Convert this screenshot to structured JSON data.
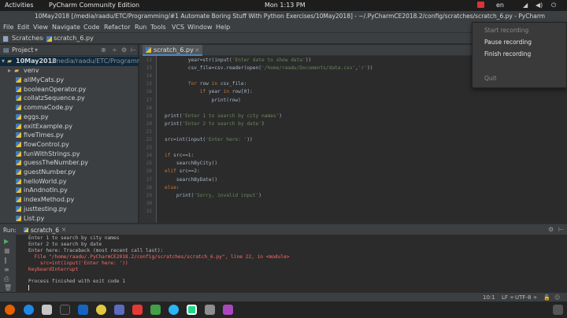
{
  "topbar": {
    "activities": "Activities",
    "app_menu": "PyCharm Community Edition",
    "clock": "Mon 1:13 PM",
    "lang": "en"
  },
  "window": {
    "title": "10May2018 [/media/raadu/ETC/Programming/#1 Automate Boring Stuff With Python Exercises/10May2018] - ~/.PyCharmCE2018.2/config/scratches/scratch_6.py - PyCharm"
  },
  "menubar": [
    "File",
    "Edit",
    "View",
    "Navigate",
    "Code",
    "Refactor",
    "Run",
    "Tools",
    "VCS",
    "Window",
    "Help"
  ],
  "navbar": {
    "crumb1": "Scratches",
    "crumb2": "scratch_6.py"
  },
  "project": {
    "header": "Project",
    "root": "10May2018",
    "root_path": "/media/raadu/ETC/Programm",
    "folder": "venv",
    "files": [
      "allMyCats.py",
      "booleanOperator.py",
      "collatzSequence.py",
      "commaCode.py",
      "eggs.py",
      "exitExample.py",
      "fiveTimes.py",
      "flowControl.py",
      "funWithStrings.py",
      "guessTheNumber.py",
      "guestNumber.py",
      "helloWorld.py",
      "inAndnotIn.py",
      "indexMethod.py",
      "justtesting.py",
      "List.py"
    ]
  },
  "editor": {
    "tab": "scratch_6.py",
    "lines": [
      {
        "n": "12",
        "code": "        year=str(input('Enter date to show data'))"
      },
      {
        "n": "13",
        "code": "        csv_file=csv.reader(open('/home/raadu/Documents/data.csv','r'))"
      },
      {
        "n": "14",
        "code": ""
      },
      {
        "n": "15",
        "code": "        for row in csv_file:"
      },
      {
        "n": "16",
        "code": "            if year in row[0]:"
      },
      {
        "n": "17",
        "code": "                print(row)"
      },
      {
        "n": "18",
        "code": ""
      },
      {
        "n": "19",
        "code": "print('Enter 1 to search by city names')"
      },
      {
        "n": "20",
        "code": "print('Enter 2 to search by date')"
      },
      {
        "n": "21",
        "code": ""
      },
      {
        "n": "22",
        "code": "src=int(input('Enter here: '))"
      },
      {
        "n": "23",
        "code": ""
      },
      {
        "n": "24",
        "code": "if src==1:"
      },
      {
        "n": "25",
        "code": "    searchByCity()"
      },
      {
        "n": "26",
        "code": "elif src==2:"
      },
      {
        "n": "27",
        "code": "    searchByDate()"
      },
      {
        "n": "28",
        "code": "else:"
      },
      {
        "n": "29",
        "code": "    print('Sorry, invalid input')"
      },
      {
        "n": "30",
        "code": ""
      },
      {
        "n": "31",
        "code": ""
      }
    ]
  },
  "run": {
    "label": "Run:",
    "tab": "scratch_6",
    "console": [
      {
        "text": "Enter 1 to search by city names",
        "color": "#bbbbbb"
      },
      {
        "text": "Enter 2 to search by date",
        "color": "#bbbbbb"
      },
      {
        "text": "Enter here: Traceback (most recent call last):",
        "color": "#bbbbbb"
      },
      {
        "text": "  File \"/home/raadu/.PyCharmCE2018.2/config/scratches/scratch_6.py\", line 22, in <module>",
        "color": "#ff6b68"
      },
      {
        "text": "    src=int(input('Enter here: '))",
        "color": "#ff6b68"
      },
      {
        "text": "KeyboardInterrupt",
        "color": "#ff6b68"
      },
      {
        "text": "",
        "color": "#bbbbbb"
      },
      {
        "text": "Process finished with exit code 1",
        "color": "#bbbbbb"
      }
    ]
  },
  "status": {
    "position": "10:1",
    "lf": "LF ÷",
    "encoding": "UTF-8 ÷"
  },
  "recording_menu": {
    "start": "Start recording",
    "pause": "Pause recording",
    "finish": "Finish recording",
    "quit": "Quit"
  },
  "colors": {
    "accent": "#4a88c7",
    "error": "#ff6b68",
    "keyword": "#cc7832",
    "string": "#6a8759"
  }
}
